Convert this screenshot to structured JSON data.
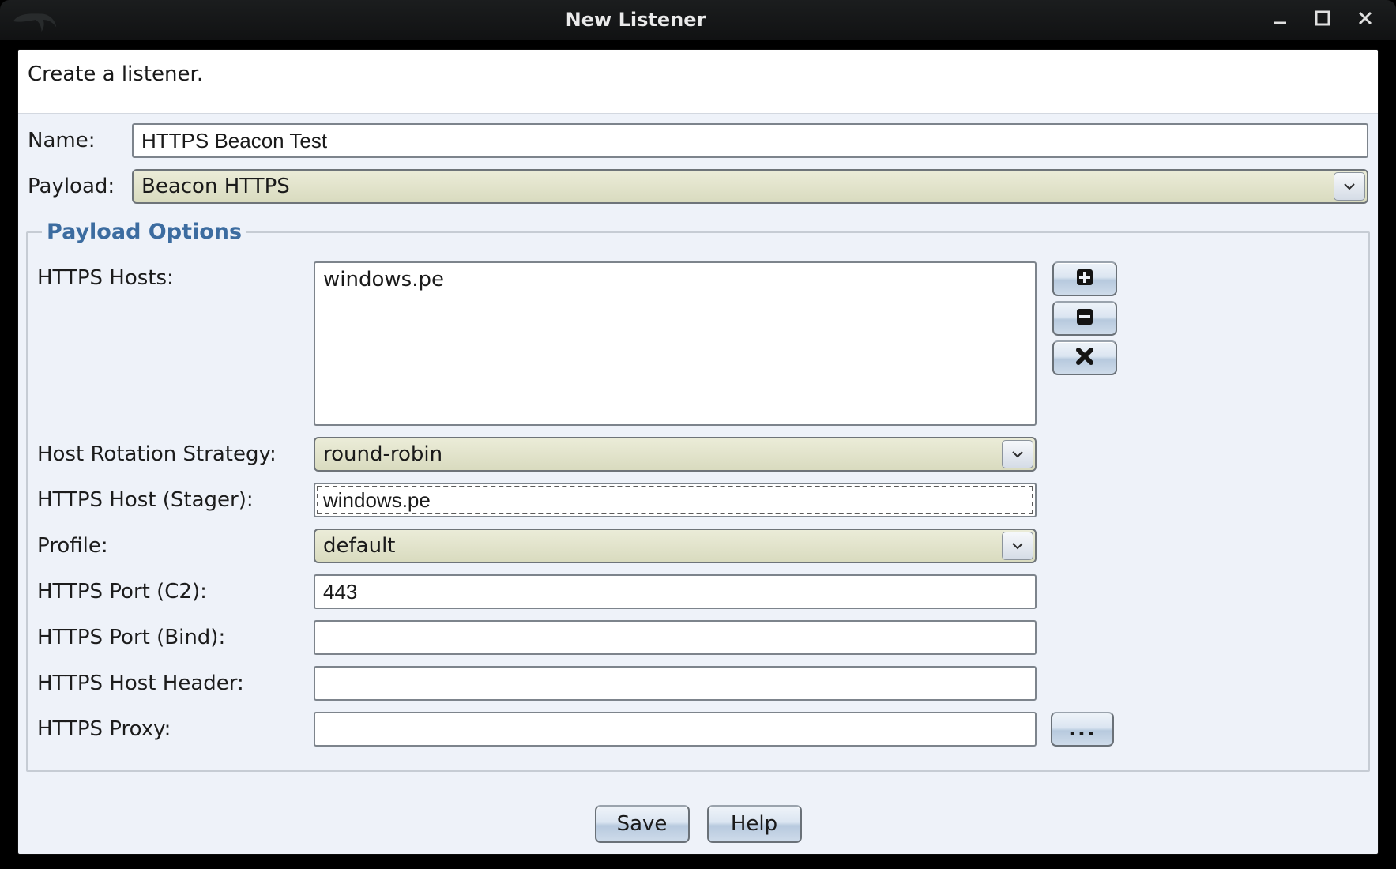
{
  "window": {
    "title": "New Listener"
  },
  "header": {
    "text": "Create a listener."
  },
  "fields": {
    "name_label": "Name:",
    "name_value": "HTTPS Beacon Test",
    "payload_label": "Payload:",
    "payload_value": "Beacon HTTPS"
  },
  "payload_options": {
    "legend": "Payload Options",
    "https_hosts_label": "HTTPS Hosts:",
    "https_hosts_value": "windows.pe",
    "host_rotation_label": "Host Rotation Strategy:",
    "host_rotation_value": "round-robin",
    "host_stager_label": "HTTPS Host (Stager):",
    "host_stager_value": "windows.pe",
    "profile_label": "Profile:",
    "profile_value": "default",
    "port_c2_label": "HTTPS Port (C2):",
    "port_c2_value": "443",
    "port_bind_label": "HTTPS Port (Bind):",
    "port_bind_value": "",
    "host_header_label": "HTTPS Host Header:",
    "host_header_value": "",
    "proxy_label": "HTTPS Proxy:",
    "proxy_value": "",
    "proxy_button": "..."
  },
  "footer": {
    "save": "Save",
    "help": "Help"
  }
}
